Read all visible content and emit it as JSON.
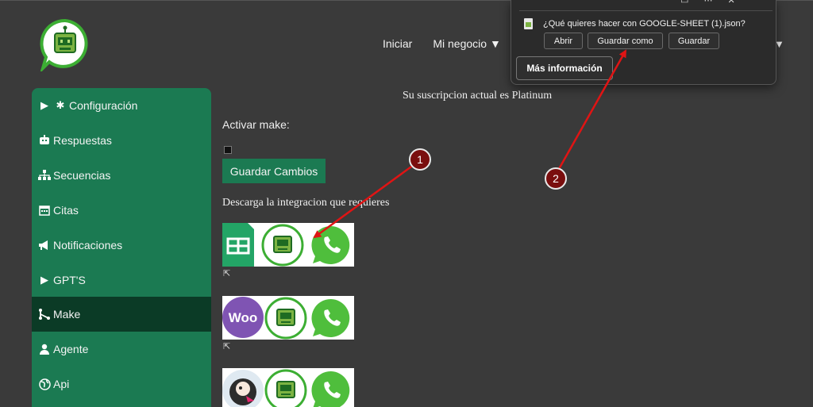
{
  "nav": {
    "items": [
      "Iniciar",
      "Mi negocio ▼"
    ],
    "caret": "▼"
  },
  "sidebar": {
    "items": [
      {
        "label": "Configuración",
        "icon": "gear-icon"
      },
      {
        "label": "Respuestas",
        "icon": "robot-icon"
      },
      {
        "label": "Secuencias",
        "icon": "sitemap-icon"
      },
      {
        "label": "Citas",
        "icon": "calendar-icon"
      },
      {
        "label": "Notificaciones",
        "icon": "megaphone-icon"
      },
      {
        "label": "GPT'S",
        "icon": "caret-right-icon"
      },
      {
        "label": "Make",
        "icon": "make-icon",
        "active": true
      },
      {
        "label": "Agente",
        "icon": "user-icon"
      },
      {
        "label": "Api",
        "icon": "globe-icon"
      }
    ]
  },
  "main": {
    "subscription": "Su suscripcion actual es Platinum",
    "activar_label": "Activar make:",
    "save_button": "Guardar Cambios",
    "descarga_text": "Descarga la integracion que requieres",
    "integrations": [
      {
        "name": "google-sheets-integration",
        "left_icon": "google-sheets-icon"
      },
      {
        "name": "woocommerce-integration",
        "left_icon": "woocommerce-icon",
        "left_text": "Woo"
      },
      {
        "name": "prestashop-integration",
        "left_icon": "prestashop-icon"
      }
    ]
  },
  "download_popup": {
    "question": "¿Qué quieres hacer con GOOGLE-SHEET (1).json?",
    "open": "Abrir",
    "save_as": "Guardar como",
    "save": "Guardar",
    "more_info": "Más información"
  },
  "annotations": {
    "badge1": "1",
    "badge2": "2"
  },
  "colors": {
    "background": "#3a3a3a",
    "sidebar": "#1b7a52",
    "sidebar_active": "#0b3b26",
    "annotation": "#e01414",
    "whatsapp": "#4fbe3c"
  }
}
